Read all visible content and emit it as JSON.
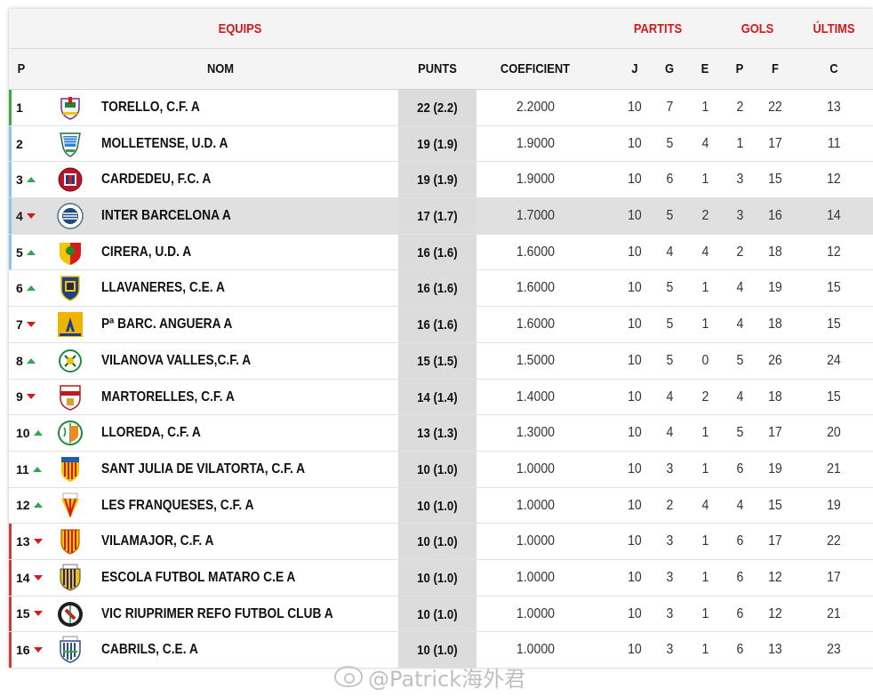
{
  "group_headers": {
    "equips": "EQUIPS",
    "partits": "PARTITS",
    "gols": "GOLS",
    "ultims": "ÚLTIMS"
  },
  "columns": {
    "p": "P",
    "nom": "NOM",
    "punts": "PUNTS",
    "coeficient": "COEFICIENT",
    "j": "J",
    "g": "G",
    "e": "E",
    "pp": "P",
    "f": "F",
    "c": "C"
  },
  "colors": {
    "accent_red": "#d11a1a",
    "up_green": "#2fa84f",
    "zone_green": "#3caa3c",
    "zone_blue": "#8ec3ea",
    "zone_red": "#d43a3a"
  },
  "rows": [
    {
      "pos": "1",
      "arrow": "none",
      "zone": "green",
      "crest": "torello-crest",
      "name": "TORELLO, C.F. A",
      "punts": "22 (2.2)",
      "coef": "2.2000",
      "j": "10",
      "g": "7",
      "e": "1",
      "p": "2",
      "f": "22",
      "c": "13"
    },
    {
      "pos": "2",
      "arrow": "none",
      "zone": "blue",
      "crest": "mollerussa-crest",
      "name": "MOLLETENSE, U.D. A",
      "punts": "19 (1.9)",
      "coef": "1.9000",
      "j": "10",
      "g": "5",
      "e": "4",
      "p": "1",
      "f": "17",
      "c": "11"
    },
    {
      "pos": "3",
      "arrow": "up",
      "zone": "blue",
      "crest": "cardedeu-crest",
      "name": "CARDEDEU, F.C. A",
      "punts": "19 (1.9)",
      "coef": "1.9000",
      "j": "10",
      "g": "6",
      "e": "1",
      "p": "3",
      "f": "15",
      "c": "12"
    },
    {
      "pos": "4",
      "arrow": "down",
      "zone": "blue",
      "crest": "inter-barcelona-crest",
      "name": "INTER BARCELONA A",
      "punts": "17 (1.7)",
      "coef": "1.7000",
      "j": "10",
      "g": "5",
      "e": "2",
      "p": "3",
      "f": "16",
      "c": "14",
      "highlight": true
    },
    {
      "pos": "5",
      "arrow": "up",
      "zone": "blue",
      "crest": "cirera-crest",
      "name": "CIRERA, U.D. A",
      "punts": "16 (1.6)",
      "coef": "1.6000",
      "j": "10",
      "g": "4",
      "e": "4",
      "p": "2",
      "f": "18",
      "c": "12"
    },
    {
      "pos": "6",
      "arrow": "up",
      "zone": "none",
      "crest": "llavaneres-crest",
      "name": "LLAVANERES, C.E. A",
      "punts": "16 (1.6)",
      "coef": "1.6000",
      "j": "10",
      "g": "5",
      "e": "1",
      "p": "4",
      "f": "19",
      "c": "15"
    },
    {
      "pos": "7",
      "arrow": "down",
      "zone": "none",
      "crest": "anguera-crest",
      "name": "Pª BARC. ANGUERA A",
      "punts": "16 (1.6)",
      "coef": "1.6000",
      "j": "10",
      "g": "5",
      "e": "1",
      "p": "4",
      "f": "18",
      "c": "15"
    },
    {
      "pos": "8",
      "arrow": "up",
      "zone": "none",
      "crest": "vilanova-crest",
      "name": "VILANOVA VALLES,C.F. A",
      "punts": "15 (1.5)",
      "coef": "1.5000",
      "j": "10",
      "g": "5",
      "e": "0",
      "p": "5",
      "f": "26",
      "c": "24"
    },
    {
      "pos": "9",
      "arrow": "down",
      "zone": "none",
      "crest": "martorelles-crest",
      "name": "MARTORELLES, C.F. A",
      "punts": "14 (1.4)",
      "coef": "1.4000",
      "j": "10",
      "g": "4",
      "e": "2",
      "p": "4",
      "f": "18",
      "c": "15"
    },
    {
      "pos": "10",
      "arrow": "up",
      "zone": "none",
      "crest": "lloreda-crest",
      "name": "LLOREDA, C.F. A",
      "punts": "13 (1.3)",
      "coef": "1.3000",
      "j": "10",
      "g": "4",
      "e": "1",
      "p": "5",
      "f": "17",
      "c": "20"
    },
    {
      "pos": "11",
      "arrow": "up",
      "zone": "none",
      "crest": "sant-julia-crest",
      "name": "SANT JULIA DE VILATORTA, C.F. A",
      "punts": "10 (1.0)",
      "coef": "1.0000",
      "j": "10",
      "g": "3",
      "e": "1",
      "p": "6",
      "f": "19",
      "c": "21"
    },
    {
      "pos": "12",
      "arrow": "up",
      "zone": "none",
      "crest": "franqueses-crest",
      "name": "LES FRANQUESES, C.F. A",
      "punts": "10 (1.0)",
      "coef": "1.0000",
      "j": "10",
      "g": "2",
      "e": "4",
      "p": "4",
      "f": "15",
      "c": "19"
    },
    {
      "pos": "13",
      "arrow": "down",
      "zone": "red",
      "crest": "vilamajor-crest",
      "name": "VILAMAJOR, C.F. A",
      "punts": "10 (1.0)",
      "coef": "1.0000",
      "j": "10",
      "g": "3",
      "e": "1",
      "p": "6",
      "f": "17",
      "c": "22"
    },
    {
      "pos": "14",
      "arrow": "down",
      "zone": "red",
      "crest": "mataro-crest",
      "name": "ESCOLA FUTBOL MATARO C.E A",
      "punts": "10 (1.0)",
      "coef": "1.0000",
      "j": "10",
      "g": "3",
      "e": "1",
      "p": "6",
      "f": "12",
      "c": "17"
    },
    {
      "pos": "15",
      "arrow": "down",
      "zone": "red",
      "crest": "vic-riuprimer-crest",
      "name": "VIC RIUPRIMER REFO FUTBOL CLUB A",
      "punts": "10 (1.0)",
      "coef": "1.0000",
      "j": "10",
      "g": "3",
      "e": "1",
      "p": "6",
      "f": "12",
      "c": "21"
    },
    {
      "pos": "16",
      "arrow": "down",
      "zone": "red",
      "crest": "cabrils-crest",
      "name": "CABRILS, C.E. A",
      "punts": "10 (1.0)",
      "coef": "1.0000",
      "j": "10",
      "g": "3",
      "e": "1",
      "p": "6",
      "f": "13",
      "c": "23"
    }
  ],
  "watermark": "@Patrick海外君"
}
